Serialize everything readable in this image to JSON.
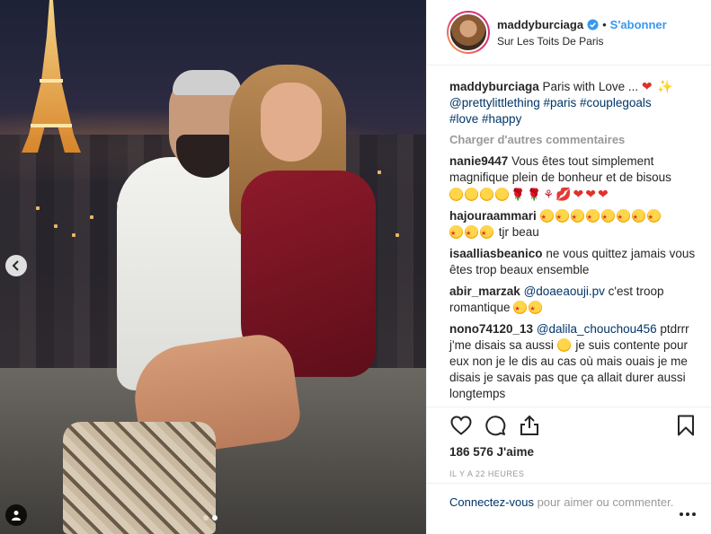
{
  "post": {
    "username": "maddyburciaga",
    "follow_label": "S'abonner",
    "separator": "•",
    "location": "Sur Les Toits De Paris",
    "caption": {
      "user": "maddyburciaga",
      "text": "Paris with Love ...",
      "mentions": "@prettylittlething",
      "hashtags_1": "#paris #couplegoals",
      "hashtags_2": "#love #happy"
    },
    "load_more": "Charger d'autres commentaires",
    "comments": [
      {
        "user": "nanie9447",
        "text": "Vous êtes tout simplement magnifique plein de bonheur et de bisous"
      },
      {
        "user": "hajouraammari",
        "text": "tjr beau"
      },
      {
        "user": "isaalliasbeanico",
        "text": "ne vous quittez jamais vous êtes trop beaux ensemble"
      },
      {
        "user": "abir_marzak",
        "mention": "@doaeaouji.pv",
        "text": "c'est troop romantique"
      },
      {
        "user": "nono74120_13",
        "mention": "@dalila_chouchou456",
        "text_a": "ptdrrr j'me disais sa aussi",
        "text_b": "je suis contente pour eux non je le dis au cas où mais ouais je me disais je savais pas que ça allait durer aussi longtemps"
      }
    ],
    "likes": "186 576 J'aime",
    "time": "IL Y A 22 HEURES",
    "login_link": "Connectez-vous",
    "login_text": "pour aimer ou commenter."
  },
  "icons": {
    "like": "heart-icon",
    "comment": "comment-icon",
    "share": "share-icon",
    "save": "bookmark-icon",
    "prev": "chevron-left-icon",
    "tag": "user-tag-icon",
    "verified": "verified-badge-icon"
  },
  "colors": {
    "link": "#003569",
    "follow": "#3897f0",
    "muted": "#999999",
    "border": "#efefef"
  },
  "carousel": {
    "count": 2,
    "active": 2
  }
}
